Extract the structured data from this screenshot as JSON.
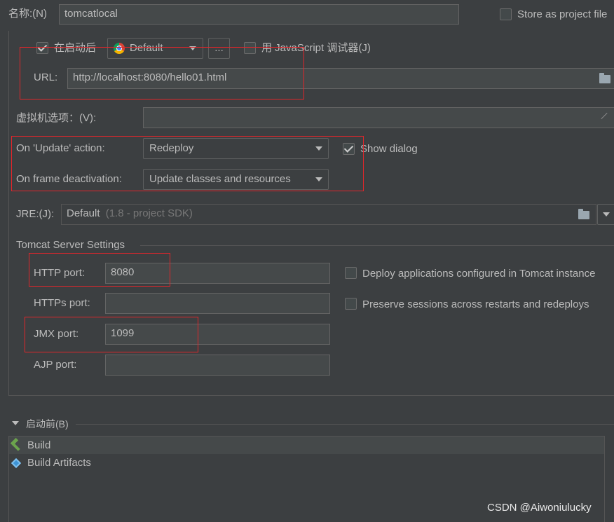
{
  "name": {
    "label": "名称:(N)",
    "value": "tomcatlocal"
  },
  "store_as_project_file": {
    "label": "Store as project file",
    "checked": false
  },
  "after_launch": {
    "label": "在启动后",
    "checked": true
  },
  "browser": {
    "value": "Default",
    "more_label": "..."
  },
  "js_debugger": {
    "label": "用 JavaScript 调试器(J)",
    "checked": false
  },
  "url": {
    "label": "URL:",
    "value": "http://localhost:8080/hello01.html"
  },
  "vm_options": {
    "label": "虚拟机选项：(V):",
    "value": ""
  },
  "on_update": {
    "label": "On 'Update' action:",
    "value": "Redeploy"
  },
  "show_dialog": {
    "label": "Show dialog",
    "checked": true
  },
  "on_frame": {
    "label": "On frame deactivation:",
    "value": "Update classes and resources"
  },
  "jre": {
    "label": "JRE:(J):",
    "value": "Default",
    "hint": "(1.8 - project SDK)"
  },
  "tomcat": {
    "section_title": "Tomcat Server Settings",
    "http_port": {
      "label": "HTTP port:",
      "value": "8080"
    },
    "https_port": {
      "label": "HTTPs port:",
      "value": ""
    },
    "jmx_port": {
      "label": "JMX port:",
      "value": "1099"
    },
    "ajp_port": {
      "label": "AJP port:",
      "value": ""
    },
    "deploy_apps": {
      "label": "Deploy applications configured in Tomcat instance",
      "checked": false
    },
    "preserve_sessions": {
      "label": "Preserve sessions across restarts and redeploys",
      "checked": false
    }
  },
  "before_launch": {
    "title": "启动前(B)",
    "items": [
      {
        "label": "Build",
        "icon": "hammer-icon"
      },
      {
        "label": "Build Artifacts",
        "icon": "artifact-icon"
      }
    ]
  },
  "watermark": "CSDN @Aiwoniulucky",
  "colors": {
    "highlight": "#e0262b",
    "background": "#3c3f41",
    "text": "#bbbbbb"
  }
}
